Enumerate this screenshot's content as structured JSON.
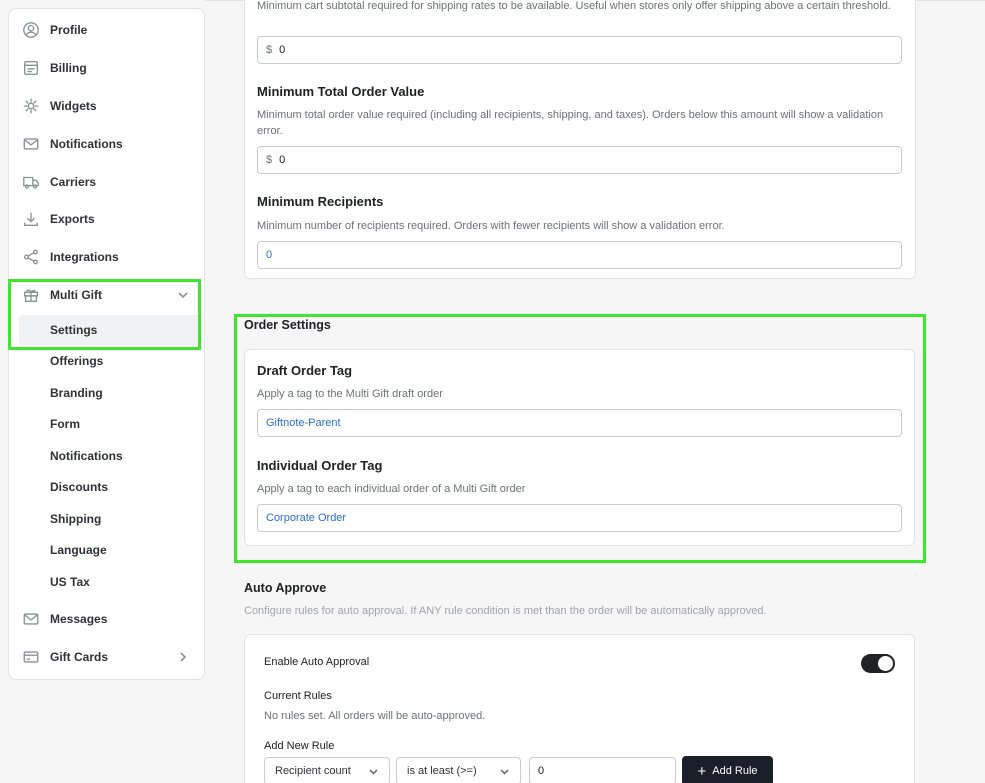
{
  "sidebar": {
    "items": [
      {
        "label": "Profile",
        "icon": "profile-icon"
      },
      {
        "label": "Billing",
        "icon": "billing-icon"
      },
      {
        "label": "Widgets",
        "icon": "widgets-icon"
      },
      {
        "label": "Notifications",
        "icon": "mail-icon"
      },
      {
        "label": "Carriers",
        "icon": "truck-icon"
      },
      {
        "label": "Exports",
        "icon": "download-icon"
      },
      {
        "label": "Integrations",
        "icon": "share-icon"
      },
      {
        "label": "Multi Gift",
        "icon": "gift-icon"
      }
    ],
    "multi_gift_sub": [
      "Settings",
      "Offerings",
      "Branding",
      "Form",
      "Notifications",
      "Discounts",
      "Shipping",
      "Language",
      "US Tax"
    ],
    "bottom_items": [
      {
        "label": "Messages",
        "icon": "mail-icon"
      },
      {
        "label": "Gift Cards",
        "icon": "credit-card-icon"
      }
    ]
  },
  "shipping": {
    "help_top": "Minimum cart subtotal required for shipping rates to be available. Useful when stores only offer shipping above a certain threshold.",
    "currency": "$",
    "subtotal_value": "0",
    "min_total_title": "Minimum Total Order Value",
    "min_total_help": "Minimum total order value required (including all recipients, shipping, and taxes). Orders below this amount will show a validation error.",
    "min_total_value": "0",
    "min_recipients_title": "Minimum Recipients",
    "min_recipients_help": "Minimum number of recipients required. Orders with fewer recipients will show a validation error.",
    "min_recipients_value": "0"
  },
  "order_settings": {
    "title": "Order Settings",
    "draft_title": "Draft Order Tag",
    "draft_help": "Apply a tag to the Multi Gift draft order",
    "draft_value": "Giftnote-Parent",
    "individual_title": "Individual Order Tag",
    "individual_help": "Apply a tag to each individual order of a Multi Gift order",
    "individual_value": "Corporate Order"
  },
  "auto_approve": {
    "title": "Auto Approve",
    "help": "Configure rules for auto approval. If ANY rule condition is met than the order will be automatically approved.",
    "enable_label": "Enable Auto Approval",
    "enabled": true,
    "current_rules_label": "Current Rules",
    "no_rules_text": "No rules set. All orders will be auto-approved.",
    "add_new_rule_label": "Add New Rule",
    "field_select": "Recipient count",
    "operator_select": "is at least (>=)",
    "value": "0",
    "add_button": "Add Rule"
  }
}
